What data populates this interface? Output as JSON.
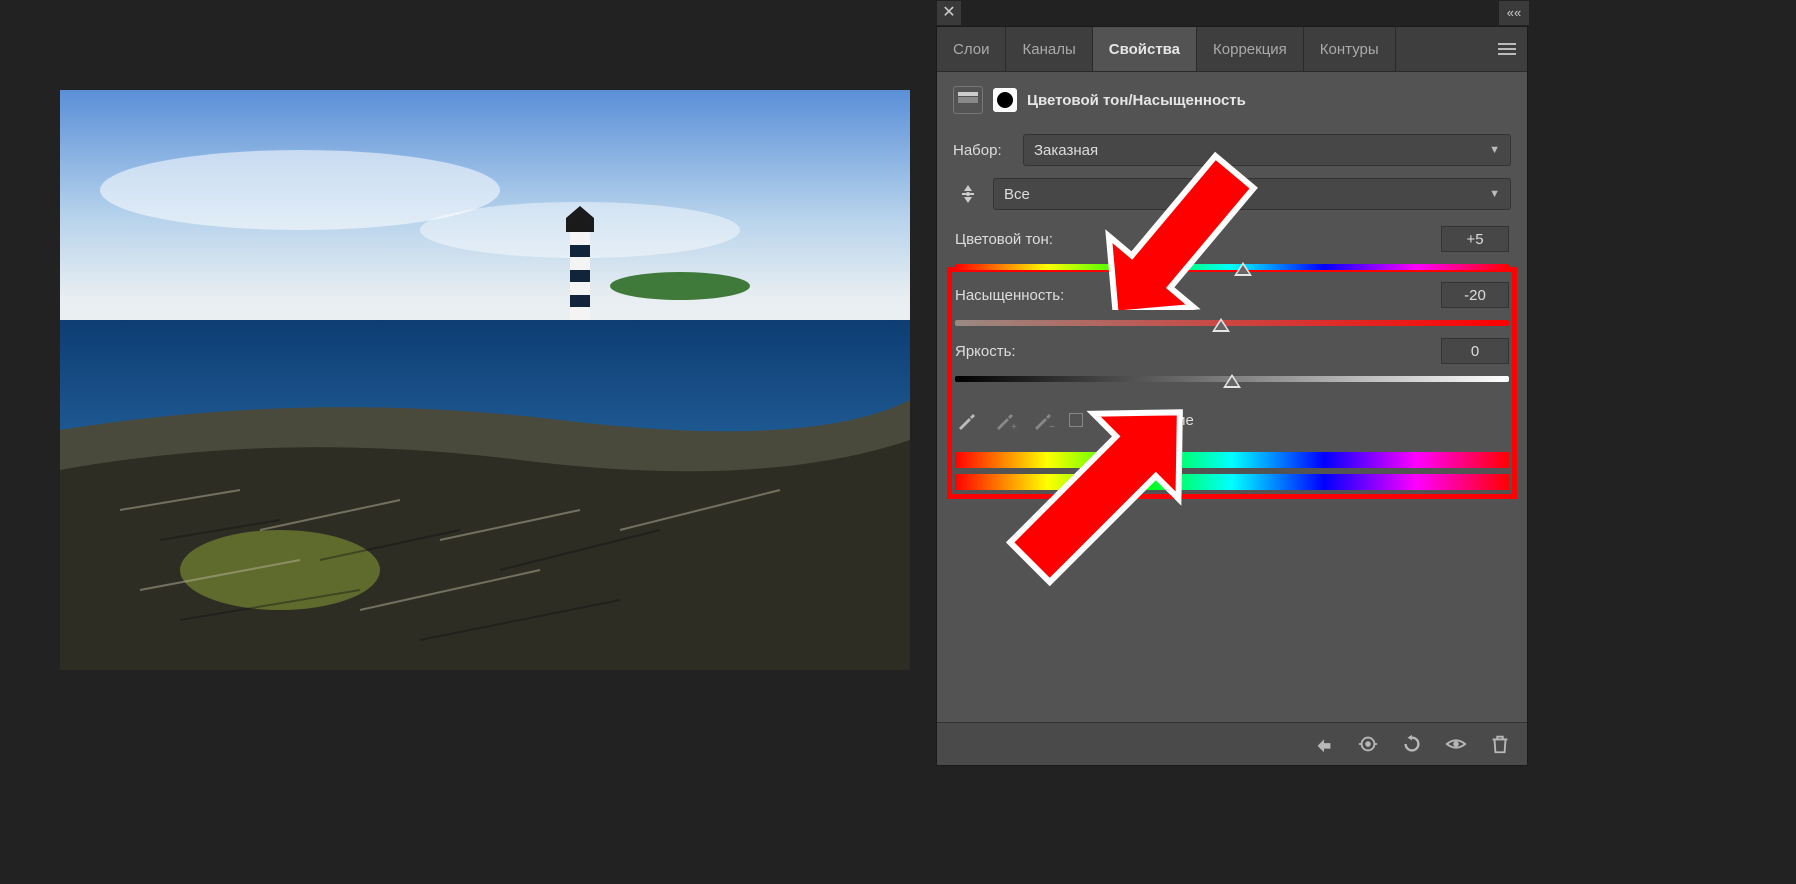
{
  "tabs": {
    "layers": "Слои",
    "channels": "Каналы",
    "properties": "Свойства",
    "adjustments": "Коррекция",
    "paths": "Контуры"
  },
  "adjustment": {
    "title": "Цветовой тон/Насыщенность"
  },
  "preset": {
    "label": "Набор:",
    "value": "Заказная"
  },
  "range": {
    "value": "Все"
  },
  "sliders": {
    "hue": {
      "label": "Цветовой тон:",
      "value": "+5",
      "pos": 52
    },
    "sat": {
      "label": "Насыщенность:",
      "value": "-20",
      "pos": 48
    },
    "bri": {
      "label": "Яркость:",
      "value": "0",
      "pos": 50
    }
  },
  "colorize": {
    "label": "Тонирование"
  },
  "icons": {
    "close": "✕",
    "expand": "««"
  }
}
